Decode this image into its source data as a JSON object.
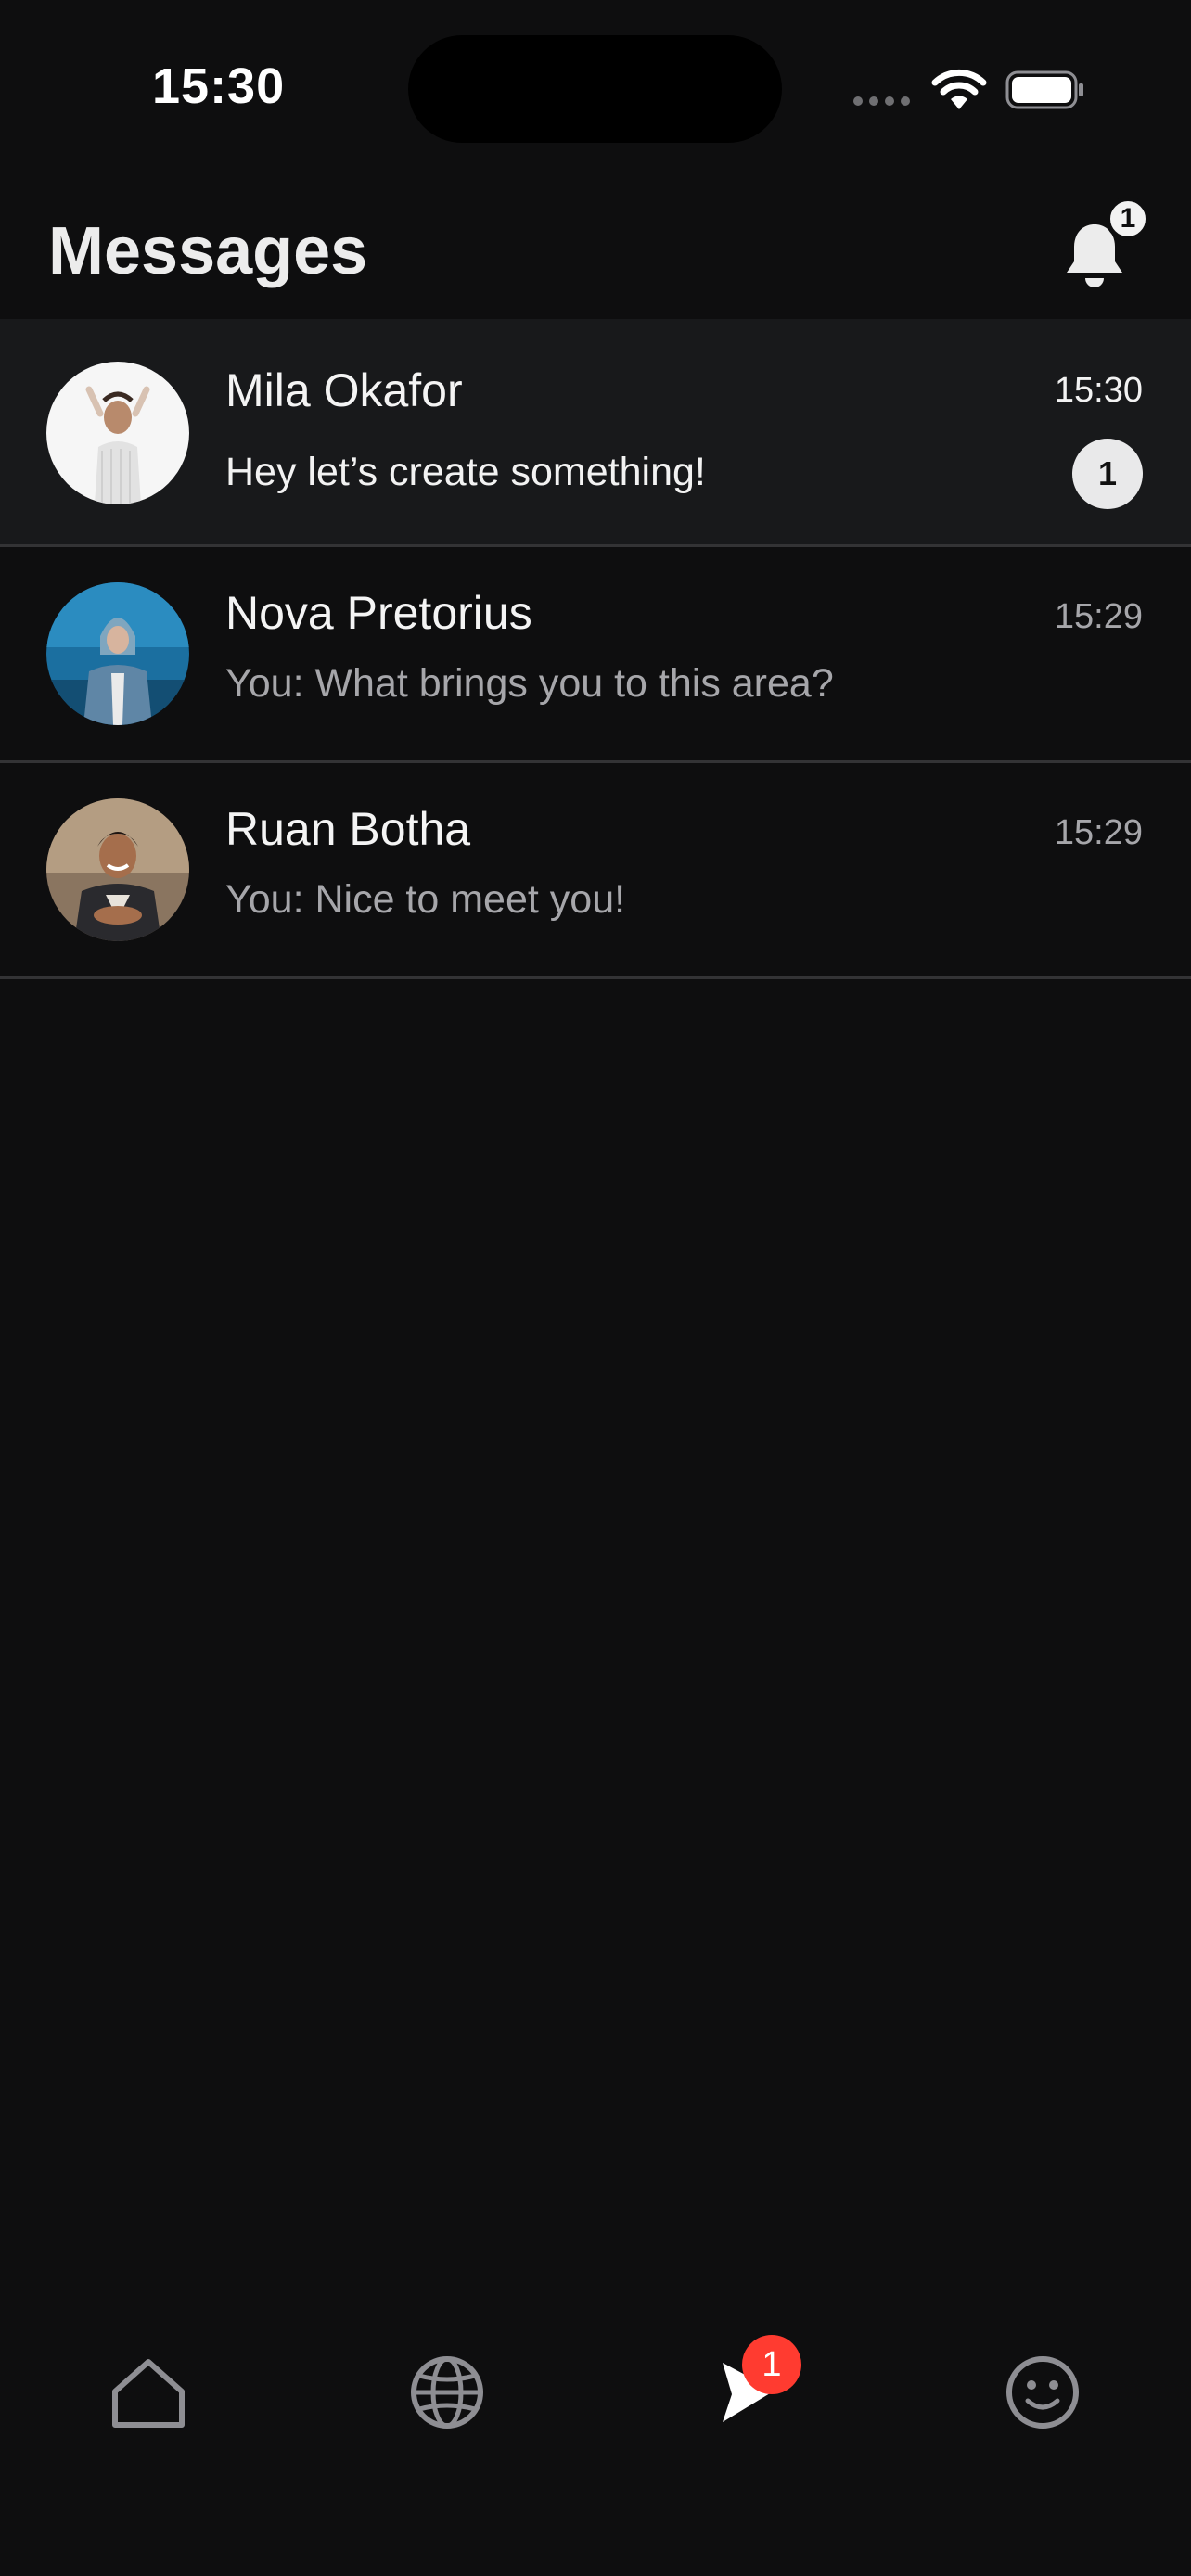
{
  "status_bar": {
    "time": "15:30"
  },
  "header": {
    "title": "Messages",
    "notifications_count": "1"
  },
  "conversations": [
    {
      "name": "Mila Okafor",
      "preview": "Hey let’s create something!",
      "time": "15:30",
      "unread_count": "1",
      "unread": true
    },
    {
      "name": "Nova Pretorius",
      "preview": "You: What brings you to this area?",
      "time": "15:29",
      "unread": false
    },
    {
      "name": "Ruan Botha",
      "preview": "You: Nice to meet you!",
      "time": "15:29",
      "unread": false
    }
  ],
  "tab_bar": {
    "tabs": [
      {
        "icon": "home-icon",
        "active": false
      },
      {
        "icon": "globe-icon",
        "active": false
      },
      {
        "icon": "send-icon",
        "active": true,
        "badge": "1"
      },
      {
        "icon": "smiley-icon",
        "active": false
      }
    ]
  },
  "colors": {
    "background": "#0e0e0f",
    "unread_row": "#18191b",
    "badge_red": "#ff3b30",
    "muted_text": "#a6a6aa"
  }
}
